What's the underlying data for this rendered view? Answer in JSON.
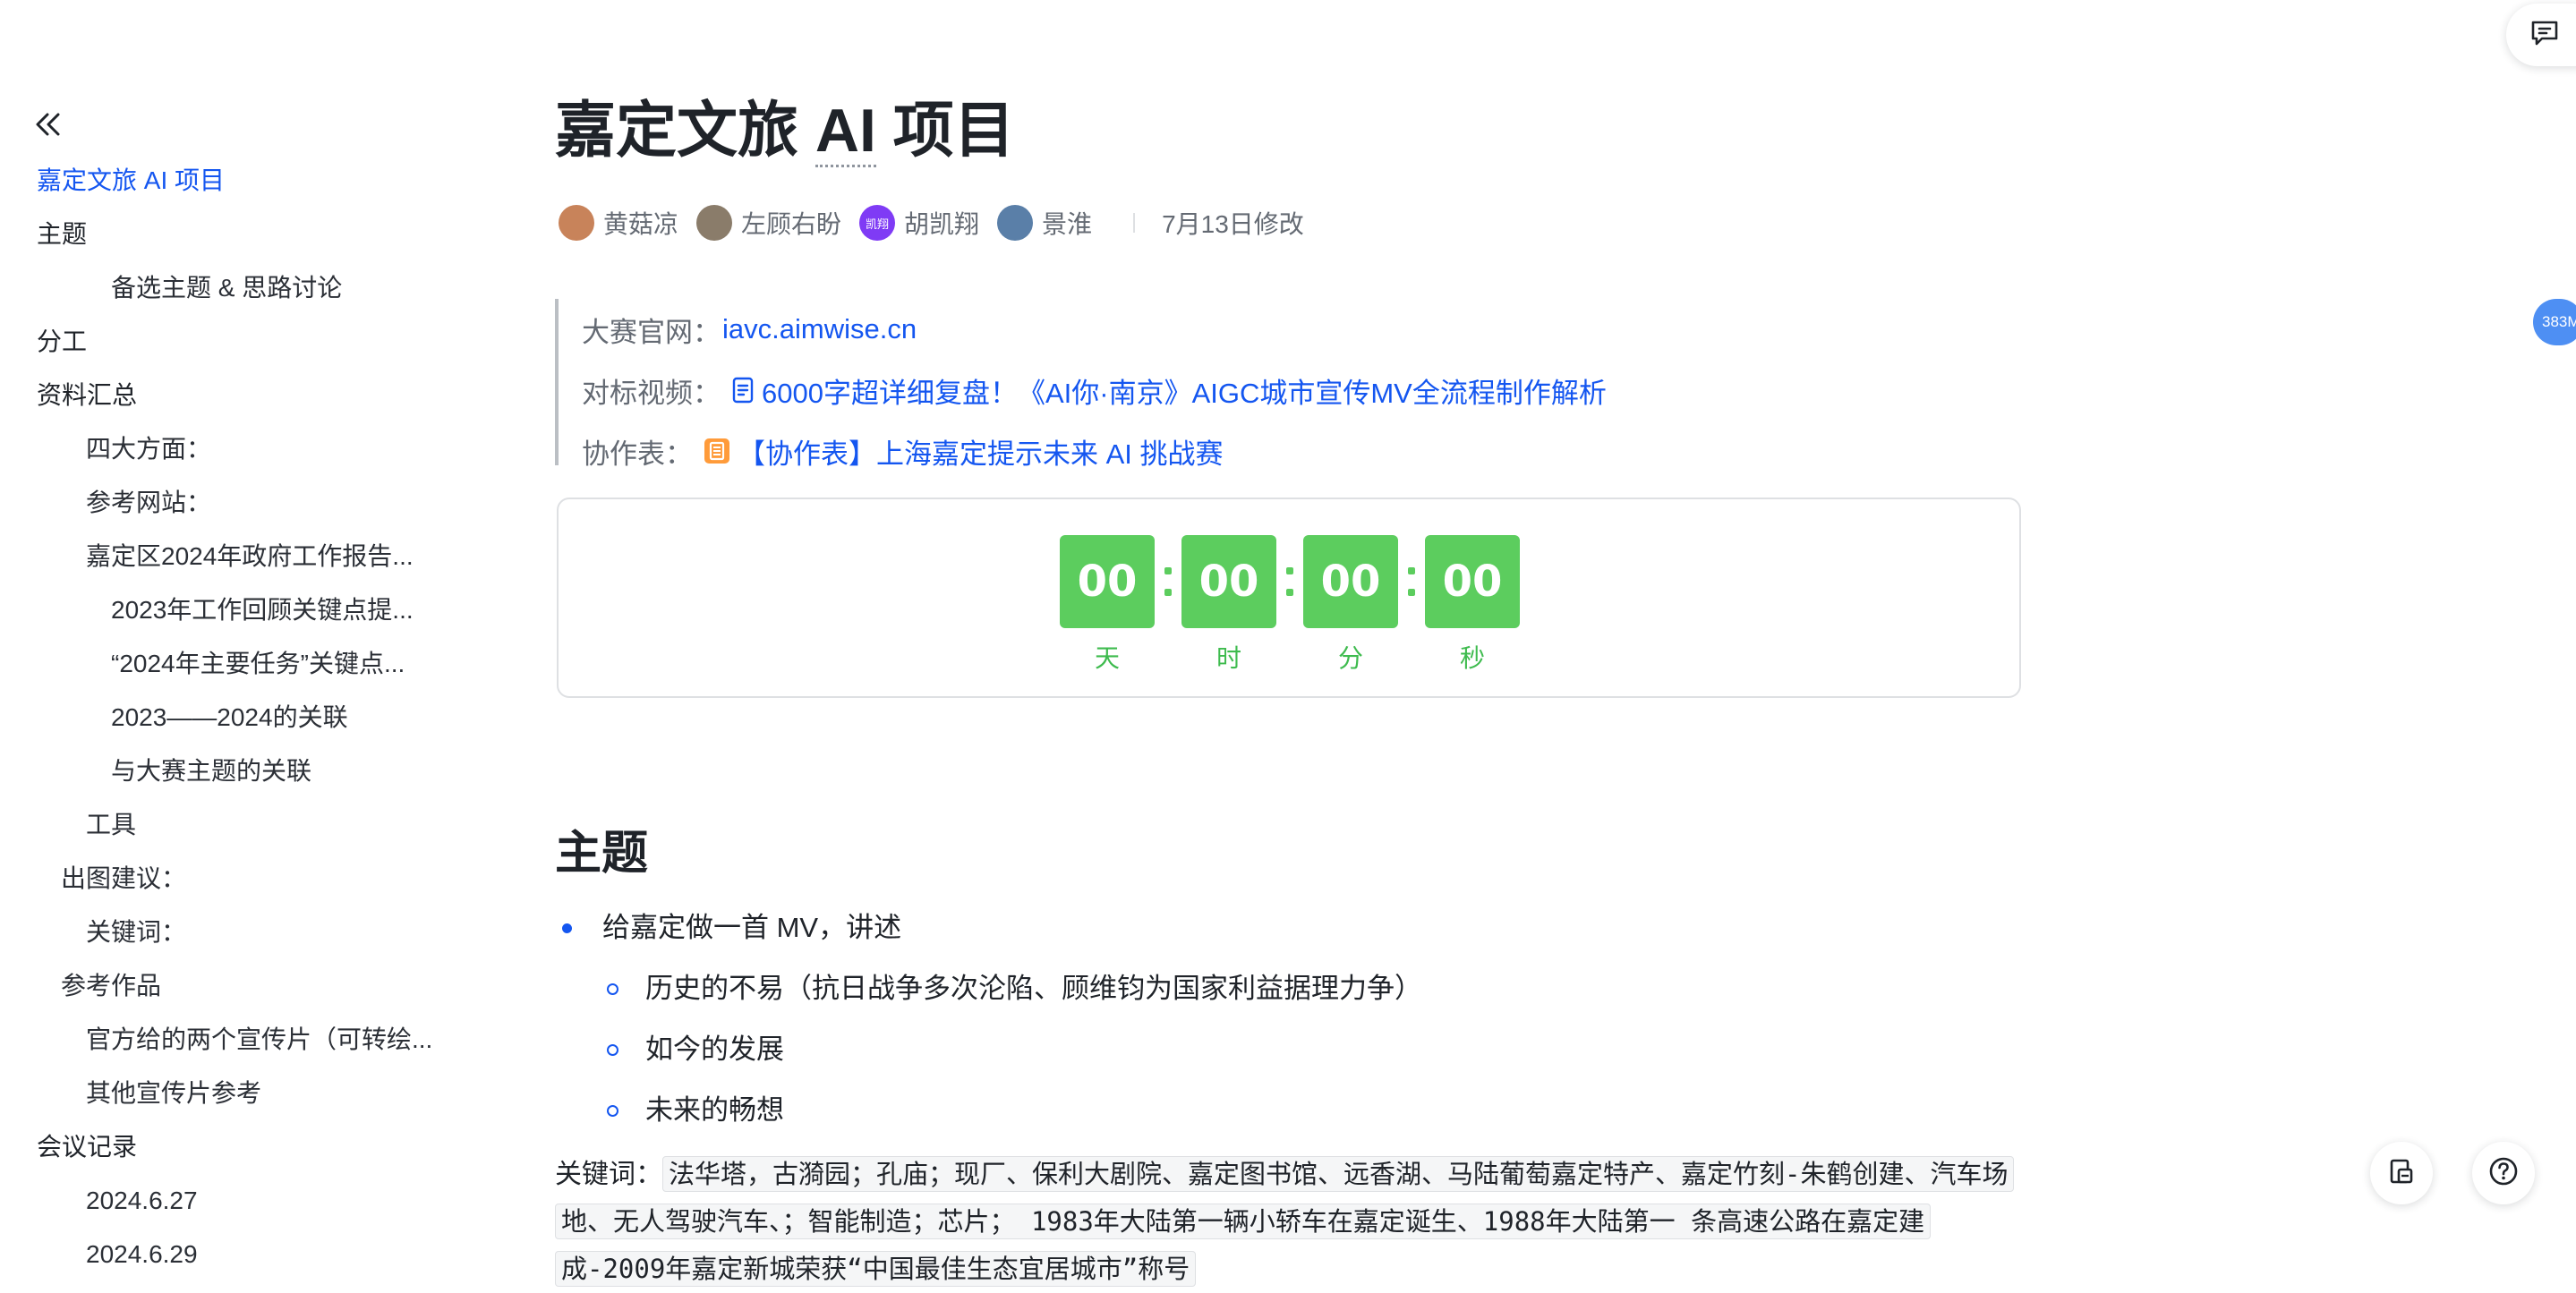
{
  "toc": {
    "items": [
      {
        "label": "嘉定文旅 AI 项目",
        "active": true
      },
      {
        "label": "主题"
      },
      {
        "label": "备选主题 & 思路讨论"
      },
      {
        "label": "分工"
      },
      {
        "label": "资料汇总"
      },
      {
        "label": "四大方面："
      },
      {
        "label": "参考网站："
      },
      {
        "label": "嘉定区2024年政府工作报告..."
      },
      {
        "label": "2023年工作回顾关键点提..."
      },
      {
        "label": "“2024年主要任务”关键点..."
      },
      {
        "label": "2023——2024的关联"
      },
      {
        "label": "与大赛主题的关联"
      },
      {
        "label": "工具"
      },
      {
        "label": "出图建议："
      },
      {
        "label": "关键词："
      },
      {
        "label": "参考作品"
      },
      {
        "label": "官方给的两个宣传片（可转绘..."
      },
      {
        "label": "其他宣传片参考"
      },
      {
        "label": "会议记录"
      },
      {
        "label": "2024.6.27"
      },
      {
        "label": "2024.6.29"
      }
    ]
  },
  "doc": {
    "title_pre": "嘉定文旅 ",
    "title_ai": "AI",
    "title_post": " 项目",
    "authors": [
      {
        "name": "黄菇凉",
        "avatar_color": "#c8835a"
      },
      {
        "name": "左顾右盼",
        "avatar_color": "#8a7c6a"
      },
      {
        "name": "胡凯翔",
        "avatar_color": "#7f3bf5",
        "avatar_text": "凯翔"
      },
      {
        "name": "景淮",
        "avatar_color": "#5a7fa8"
      }
    ],
    "modified": "7月13日修改"
  },
  "callout": {
    "site_label": "大赛官网：",
    "site_link": "iavc.aimwise.cn",
    "video_label": "对标视频：",
    "video_link": "6000字超详细复盘！《AI你·南京》AIGC城市宣传MV全流程制作解析",
    "sheet_label": "协作表：",
    "sheet_link": "【协作表】上海嘉定提示未来 AI 挑战赛"
  },
  "countdown": {
    "units": [
      {
        "value": "00",
        "label": "天"
      },
      {
        "value": "00",
        "label": "时"
      },
      {
        "value": "00",
        "label": "分"
      },
      {
        "value": "00",
        "label": "秒"
      }
    ]
  },
  "section": {
    "heading": "主题",
    "bullet": "给嘉定做一首 MV，讲述",
    "sub_bullets": [
      "历史的不易（抗日战争多次沦陷、顾维钧为国家利益据理力争）",
      "如今的发展",
      "未来的畅想"
    ],
    "keywords_label": "关键词：",
    "keywords": "法华塔，古漪园；孔庙；现厂、保利大剧院、嘉定图书馆、远香湖、马陆葡萄嘉定特产、嘉定竹刻-朱鹤创建、汽车场地、无人驾驶汽车、；智能制造；芯片；  1983年大陆第一辆小轿车在嘉定诞生、1988年大陆第一 条高速公路在嘉定建成-2009年嘉定新城荣获“中国最佳生态宜居城市”称号 "
  },
  "ui": {
    "memory_badge": "383M"
  }
}
